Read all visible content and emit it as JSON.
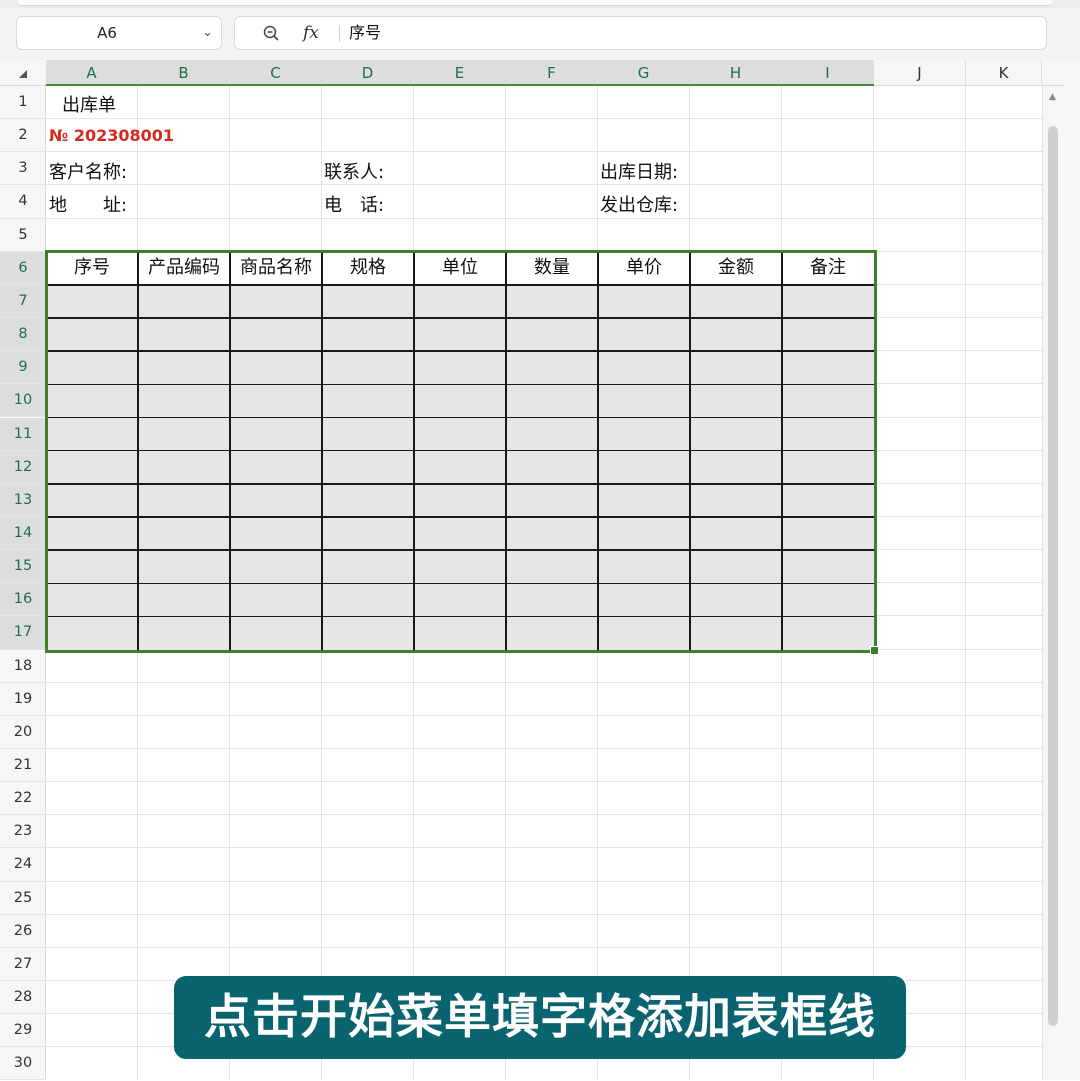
{
  "formula_bar": {
    "name_box": "A6",
    "fx_label": "fx",
    "content": "序号"
  },
  "columns": [
    "A",
    "B",
    "C",
    "D",
    "E",
    "F",
    "G",
    "H",
    "I",
    "J",
    "K"
  ],
  "rows": [
    "1",
    "2",
    "3",
    "4",
    "5",
    "6",
    "7",
    "8",
    "9",
    "10",
    "11",
    "12",
    "13",
    "14",
    "15",
    "16",
    "17",
    "18",
    "19",
    "20",
    "21",
    "22",
    "23",
    "24",
    "25",
    "26",
    "27",
    "28",
    "29",
    "30"
  ],
  "cells": {
    "title": "出库单",
    "doc_no": "№ 202308001",
    "customer_name": "客户名称:",
    "contact": "联系人:",
    "ship_date": "出库日期:",
    "address": "地　　址:",
    "phone": "电　话:",
    "warehouse": "发出仓库:"
  },
  "table": {
    "headers": [
      "序号",
      "产品编码",
      "商品名称",
      "规格",
      "单位",
      "数量",
      "单价",
      "金额",
      "备注"
    ],
    "empty_rows": 11
  },
  "caption": "点击开始菜单填字格添加表框线",
  "colors": {
    "selection": "#3f7f2b",
    "doc_no": "#d52b1e",
    "caption_bg": "#096470",
    "table_fill": "#e6e6e6"
  }
}
